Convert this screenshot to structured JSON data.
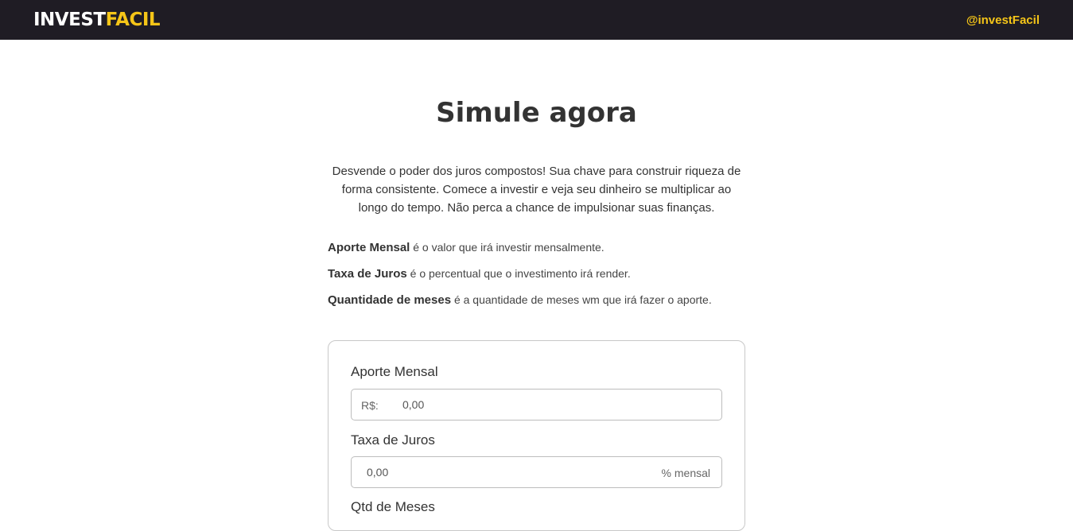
{
  "header": {
    "logo_part1": "INVEST",
    "logo_part2": "FACIL",
    "handle": "@investFacil",
    "bg_color": "#1f1c24",
    "accent_color": "#f5c518"
  },
  "main": {
    "title": "Simule agora",
    "intro_lines": [
      "Desvende o poder dos juros compostos! Sua chave para construir riqueza de",
      "forma consistente. Comece a investir e veja seu dinheiro se multiplicar ao",
      "longo do tempo. Não perca a chance de impulsionar suas finanças."
    ],
    "definitions": [
      {
        "term": "Aporte Mensal",
        "text": " é o valor que irá investir mensalmente."
      },
      {
        "term": "Taxa de Juros",
        "text": " é o percentual que o investimento irá render."
      },
      {
        "term": "Quantidade de meses",
        "text": " é a quantidade de meses wm que irá fazer o aporte."
      }
    ]
  },
  "form": {
    "aporte": {
      "label": "Aporte Mensal",
      "prefix": "R$:",
      "placeholder": "0,00",
      "value": ""
    },
    "taxa": {
      "label": "Taxa de Juros",
      "placeholder": "0,00",
      "suffix": "% mensal",
      "value": ""
    },
    "meses": {
      "label": "Qtd de Meses"
    }
  }
}
